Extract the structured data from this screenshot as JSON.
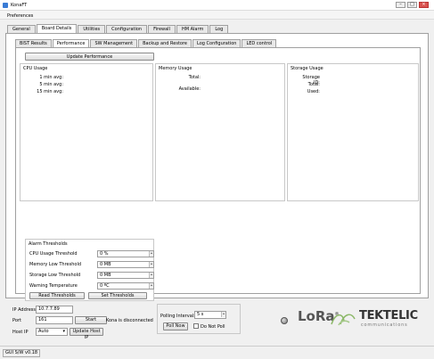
{
  "window": {
    "title": "KonaFT"
  },
  "menubar": {
    "items": [
      "Preferences"
    ]
  },
  "tabs": [
    "General",
    "Board Details",
    "Utilities",
    "Configuration",
    "Firewall",
    "HM Alarm",
    "Log"
  ],
  "subtabs": [
    "BIST Results",
    "Performance",
    "SW Management",
    "Backup and Restore",
    "Log Configuration",
    "LED control"
  ],
  "performance": {
    "update_button": "Update Performance",
    "cpu": {
      "title": "CPU Usage",
      "labels": [
        "1 min avg:",
        "5 min avg:",
        "15 min avg:"
      ]
    },
    "memory": {
      "title": "Memory Usage",
      "labels": [
        "Total:",
        "Available:"
      ]
    },
    "storage": {
      "title": "Storage Usage",
      "labels": [
        "Storage ID:",
        "Total:",
        "Used:"
      ]
    },
    "alarm": {
      "title": "Alarm Thresholds",
      "rows": [
        {
          "label": "CPU Usage Threshold",
          "value": "0 %"
        },
        {
          "label": "Memory Low Threshold",
          "value": "0 MB"
        },
        {
          "label": "Storage Low Threshold",
          "value": "0 MB"
        },
        {
          "label": "Warning Temperature",
          "value": "0 ºC"
        }
      ],
      "read_button": "Read Thresholds",
      "set_button": "Set Thresholds"
    }
  },
  "connection": {
    "ip_label": "IP Address",
    "ip_value": "10.7.7.89",
    "port_label": "Port",
    "port_value": "161",
    "start_button": "Start",
    "status": "Kona is disconnected",
    "hostip_label": "Host IP",
    "hostip_value": "Auto",
    "update_hostip_button": "Update Host IP",
    "polling_label": "Polling Interval:",
    "polling_value": "5 s",
    "poll_now_button": "Poll Now",
    "do_not_poll_label": "Do Not Poll"
  },
  "branding": {
    "lora": "LoRa",
    "lora_mark": "®",
    "company": "TEKTELIC",
    "company_sub": "communications"
  },
  "status_bar": {
    "version": "GUI S/W v0.18"
  },
  "colors": {
    "window_bg": "#f0f0f0",
    "led": "#888888",
    "lora_text": "#555555",
    "tektelic_text": "#333333",
    "leaf_green": "#8bb867"
  }
}
